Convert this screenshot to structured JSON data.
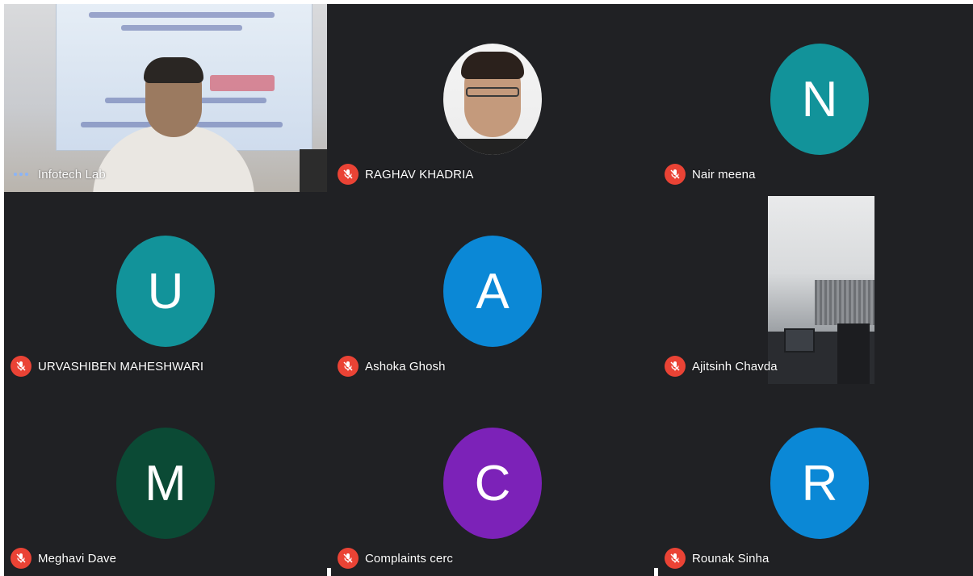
{
  "participants": [
    {
      "name": "Infotech Lab",
      "type": "video",
      "status": "speaking"
    },
    {
      "name": "RAGHAV KHADRIA",
      "type": "photo",
      "status": "muted"
    },
    {
      "name": "Nair meena",
      "type": "initial",
      "initial": "N",
      "color": "#12939a",
      "status": "muted"
    },
    {
      "name": "URVASHIBEN MAHESHWARI",
      "type": "initial",
      "initial": "U",
      "color": "#12939a",
      "status": "muted"
    },
    {
      "name": "Ashoka Ghosh",
      "type": "initial",
      "initial": "A",
      "color": "#0b88d6",
      "status": "muted"
    },
    {
      "name": "Ajitsinh Chavda",
      "type": "video",
      "status": "muted"
    },
    {
      "name": "Meghavi Dave",
      "type": "initial",
      "initial": "M",
      "color": "#0b4a35",
      "status": "muted"
    },
    {
      "name": "Complaints cerc",
      "type": "initial",
      "initial": "C",
      "color": "#7c22b8",
      "status": "muted"
    },
    {
      "name": "Rounak Sinha",
      "type": "initial",
      "initial": "R",
      "color": "#0b88d6",
      "status": "muted"
    }
  ],
  "colors": {
    "background": "#202124",
    "mute_badge": "#ea4335",
    "speaking_dots": "#8ab4f8"
  },
  "icons": {
    "muted": "mic-off-icon",
    "speaking": "more-dots-icon"
  }
}
